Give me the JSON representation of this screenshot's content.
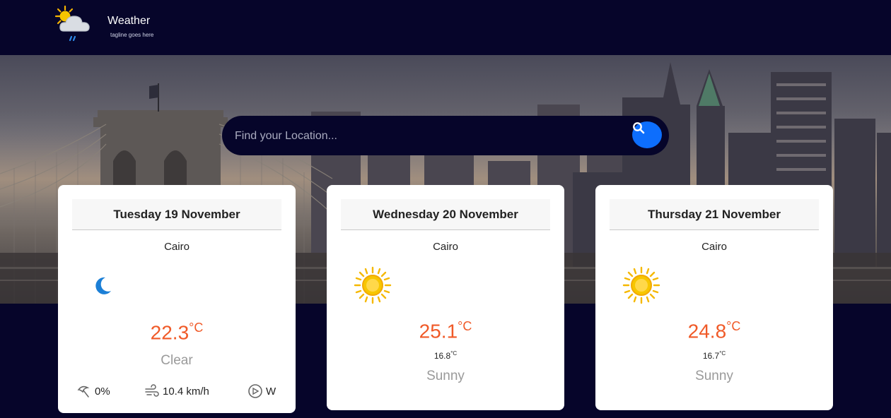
{
  "header": {
    "title": "Weather",
    "tagline": "tagline goes here"
  },
  "search": {
    "placeholder": "Find your Location..."
  },
  "colors": {
    "background": "#06052a",
    "accent": "#0d6efd",
    "temperature": "#f05a28",
    "condition": "#9a9a9a"
  },
  "forecast": [
    {
      "date": "Tuesday 19 November",
      "city": "Cairo",
      "icon": "moon-icon",
      "temp": "22.3",
      "unit": "°C",
      "condition": "Clear",
      "stats": {
        "rain": "0%",
        "wind": "10.4 km/h",
        "direction": "W"
      }
    },
    {
      "date": "Wednesday 20 November",
      "city": "Cairo",
      "icon": "sun-icon",
      "temp": "25.1",
      "unit": "°C",
      "min_temp": "16.8",
      "min_unit": "°C",
      "condition": "Sunny"
    },
    {
      "date": "Thursday 21 November",
      "city": "Cairo",
      "icon": "sun-icon",
      "temp": "24.8",
      "unit": "°C",
      "min_temp": "16.7",
      "min_unit": "°C",
      "condition": "Sunny"
    }
  ]
}
